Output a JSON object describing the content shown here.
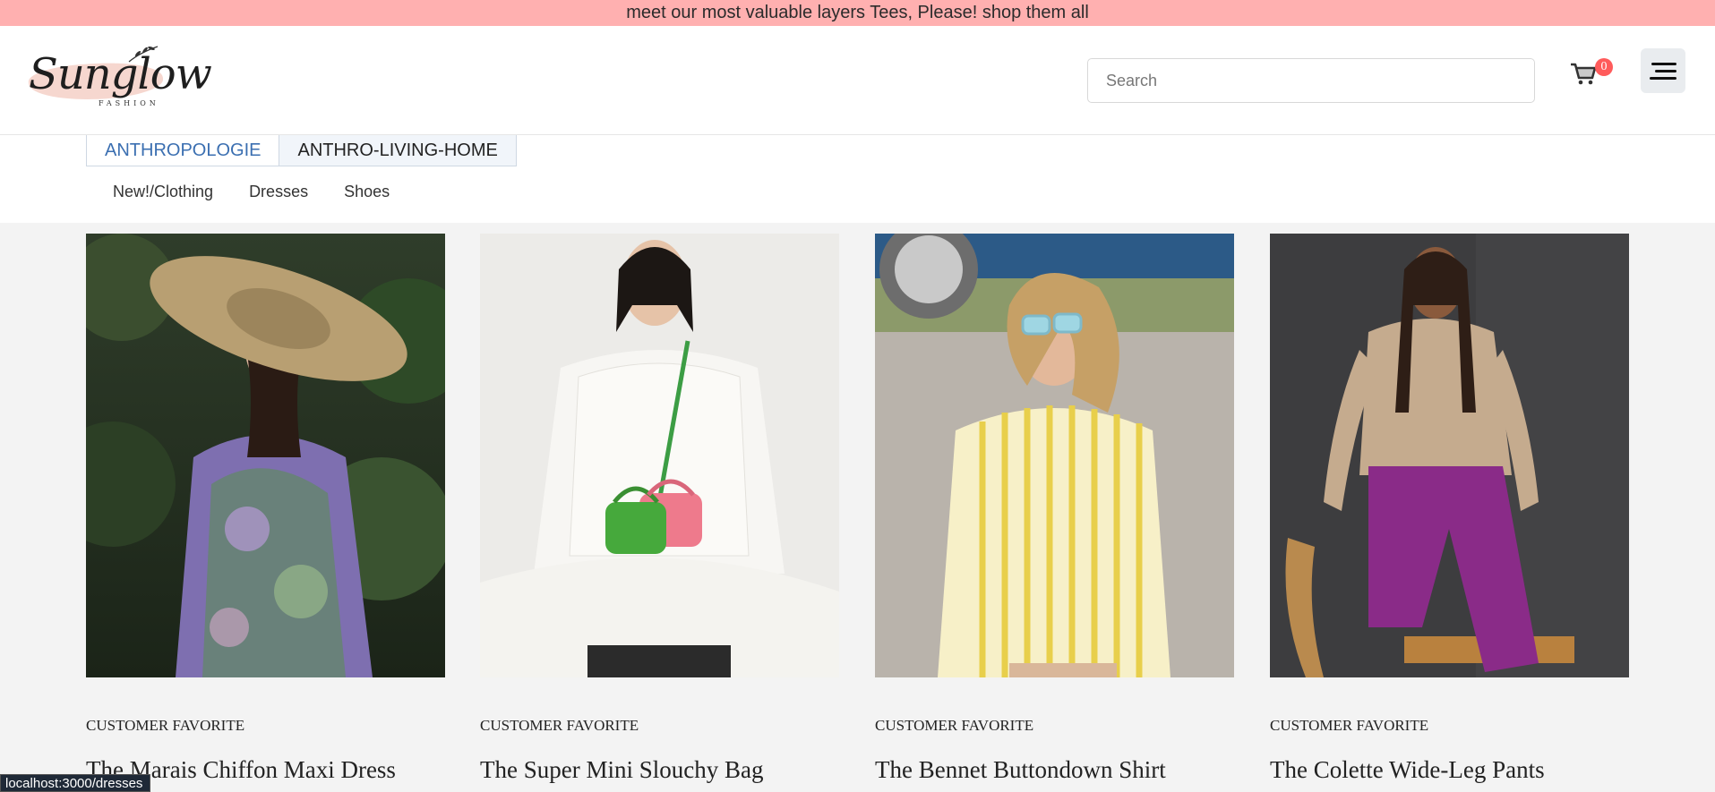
{
  "promo": {
    "text": "meet our most valuable layers Tees, Please! shop them all"
  },
  "logo": {
    "script": "Sunglow",
    "sub": "FASHION"
  },
  "search": {
    "placeholder": "Search",
    "value": ""
  },
  "cart": {
    "count": "0"
  },
  "tabs": [
    {
      "label": "ANTHROPOLOGIE",
      "active": true
    },
    {
      "label": "ANTHRO-LIVING-HOME",
      "active": false
    }
  ],
  "subnav": [
    {
      "label": "New!/Clothing"
    },
    {
      "label": "Dresses"
    },
    {
      "label": "Shoes"
    }
  ],
  "products": [
    {
      "badge": "CUSTOMER FAVORITE",
      "title": "The Marais Chiffon Maxi Dress"
    },
    {
      "badge": "CUSTOMER FAVORITE",
      "title": "The Super Mini Slouchy Bag"
    },
    {
      "badge": "CUSTOMER FAVORITE",
      "title": "The Bennet Buttondown Shirt"
    },
    {
      "badge": "CUSTOMER FAVORITE",
      "title": "The Colette Wide-Leg Pants"
    }
  ],
  "status_bar": {
    "url": "localhost:3000/dresses"
  },
  "colors": {
    "promo_bg": "#ffb0b0",
    "active_tab": "#3b6fb1",
    "cart_badge": "#ff5b5b"
  }
}
